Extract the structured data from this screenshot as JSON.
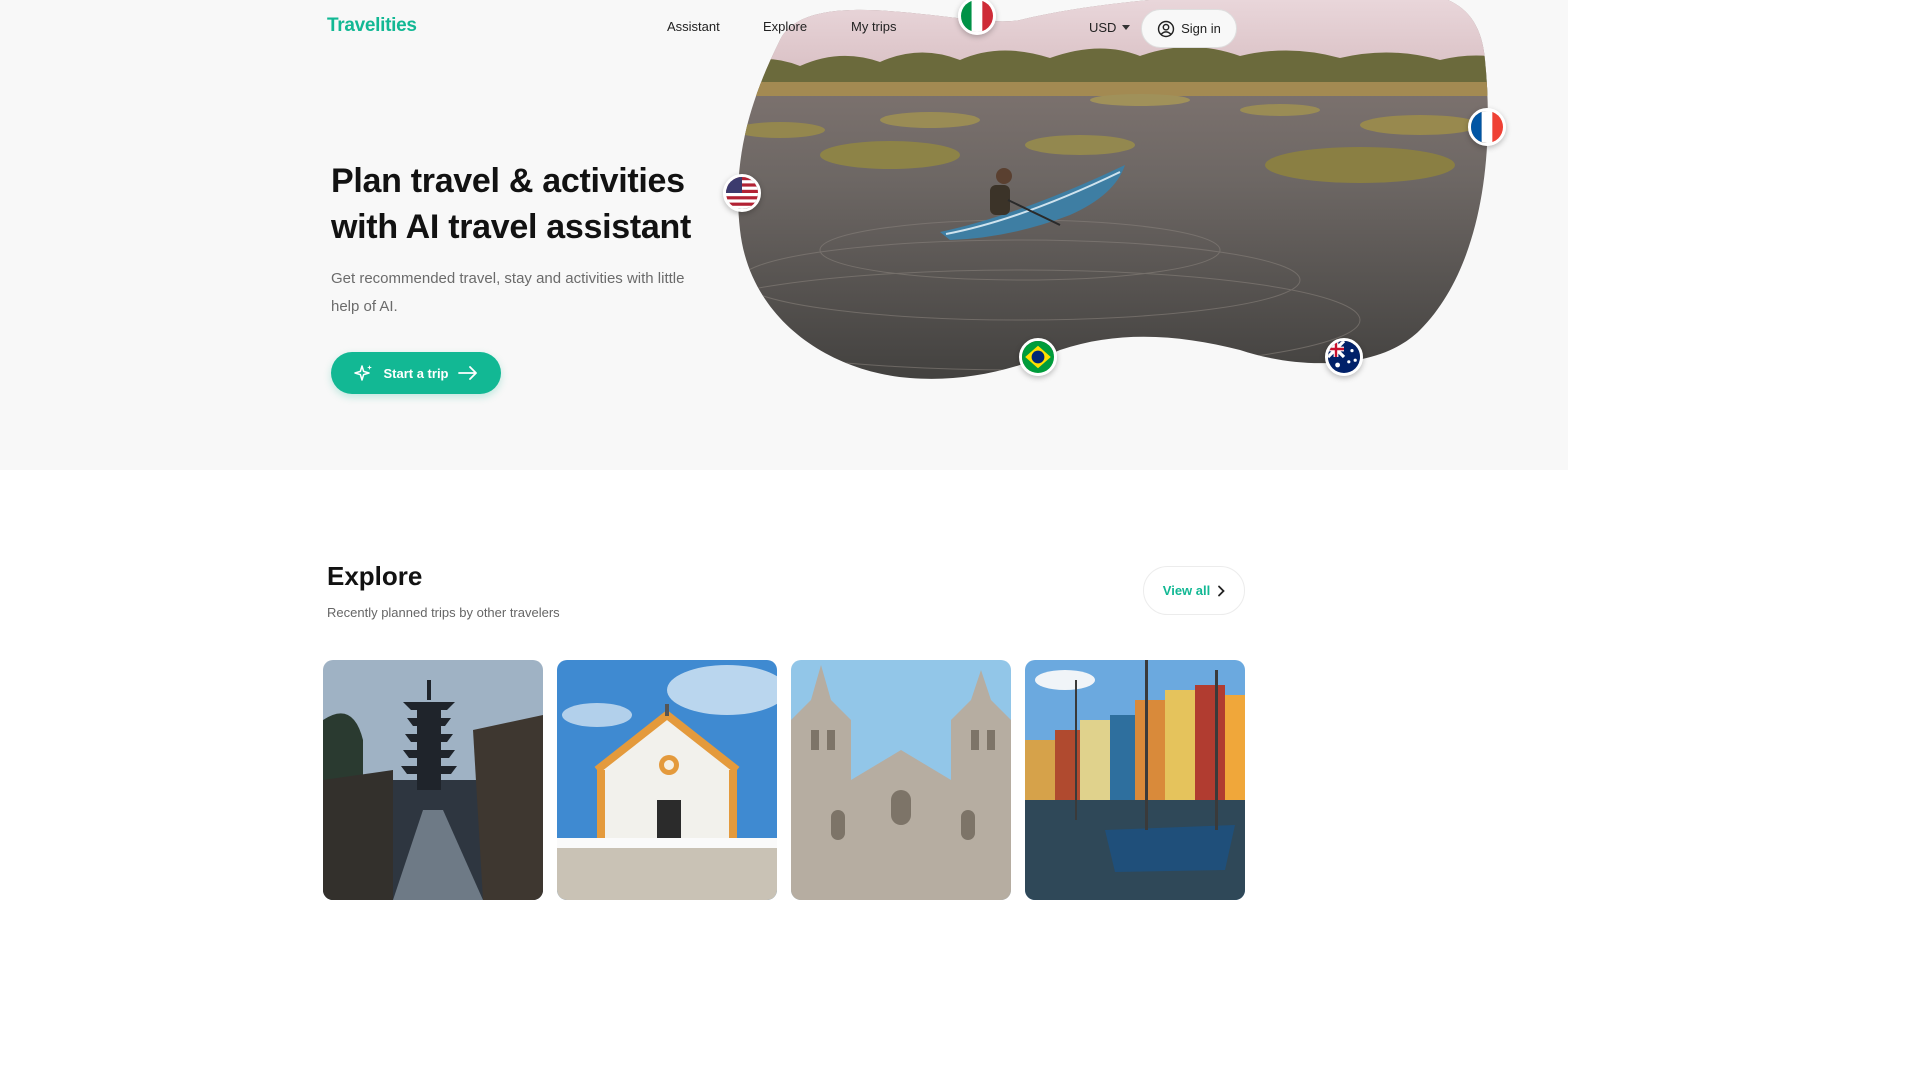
{
  "header": {
    "brand": "Travelities",
    "nav": [
      "Assistant",
      "Explore",
      "My trips"
    ],
    "currency": "USD",
    "signin_label": "Sign in"
  },
  "hero": {
    "title_line1": "Plan travel & activities",
    "title_line2": "with AI travel assistant",
    "subtitle_line1": "Get recommended travel, stay and activities with little",
    "subtitle_line2": "help of AI.",
    "cta_label": "Start a trip"
  },
  "flags": [
    "italy",
    "united-states",
    "france",
    "brazil",
    "australia"
  ],
  "explore": {
    "title": "Explore",
    "subtitle": "Recently planned trips by other travelers",
    "view_all_label": "View all",
    "cards": [
      "kyoto-pagoda-street",
      "white-chapel",
      "gothic-cathedral",
      "harbor-colorful-houses"
    ]
  },
  "colors": {
    "accent": "#12b894",
    "hero_bg": "#f8f8f8",
    "text_dark": "#121212",
    "text_muted": "#6b6b6b"
  },
  "icons": [
    "user-circle-icon",
    "chevron-down-icon",
    "sparkle-icon",
    "arrow-right-icon",
    "chevron-right-icon"
  ]
}
